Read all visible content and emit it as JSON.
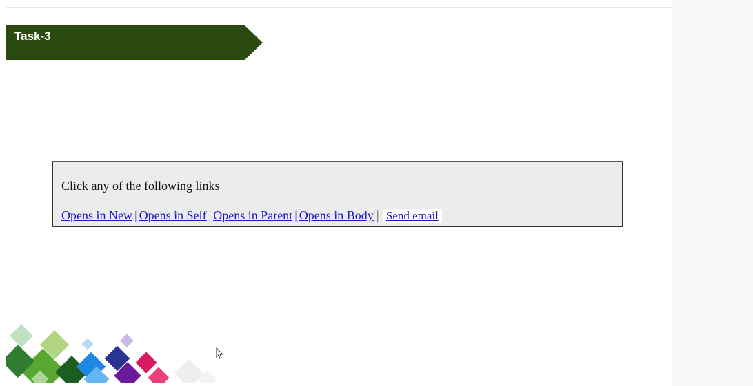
{
  "task": {
    "title": "Task-3",
    "banner_color": "#2a4a0f"
  },
  "box": {
    "prompt": "Click any of the following links",
    "links": [
      {
        "label": "Opens in New"
      },
      {
        "label": "Opens in Self"
      },
      {
        "label": "Opens in Parent"
      },
      {
        "label": "Opens in Body"
      },
      {
        "label": "Send email"
      }
    ],
    "separator": "|"
  },
  "colors": {
    "link": "#1f17c9",
    "box_bg": "#ececec",
    "box_border": "#333333"
  }
}
